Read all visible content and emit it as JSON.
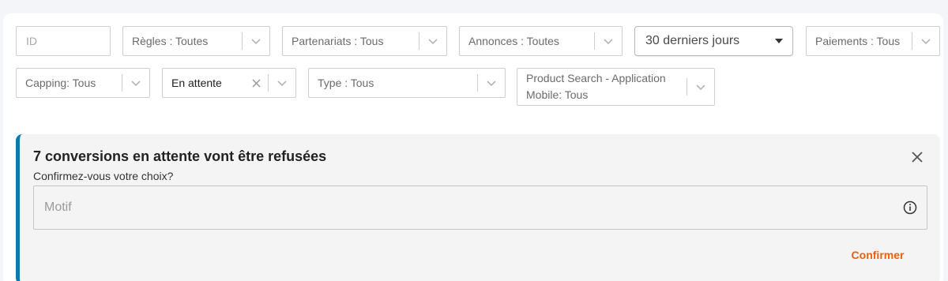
{
  "filters": {
    "id_placeholder": "ID",
    "rules": "Règles : Toutes",
    "partnerships": "Partenariats : Tous",
    "ads": "Annonces : Toutes",
    "date_range": "30 derniers jours",
    "payments": "Paiements : Tous",
    "capping": "Capping: Tous",
    "status": "En attente",
    "type": "Type : Tous",
    "product_search": "Product Search - Application Mobile: Tous"
  },
  "alert": {
    "title": "7 conversions en attente vont être refusées",
    "subtitle": "Confirmez-vous votre choix?",
    "reason_placeholder": "Motif",
    "confirm_label": "Confirmer",
    "accent_color": "#0a7bab",
    "confirm_color": "#e8620e"
  },
  "icons": {
    "dropdown": "chevron-down-icon",
    "clear": "close-icon",
    "info": "info-icon",
    "caret": "caret-down-icon"
  }
}
